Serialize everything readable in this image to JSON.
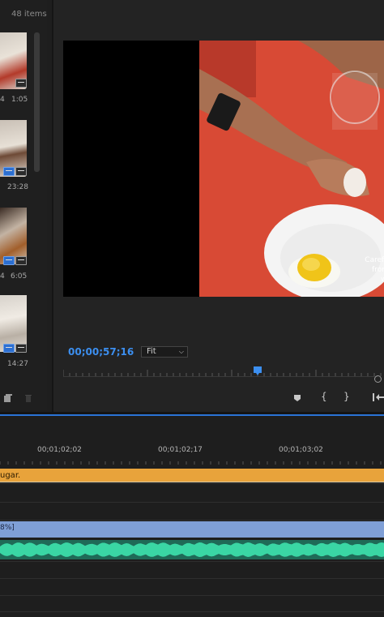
{
  "project": {
    "items_count": "48 items",
    "thumbnails": [
      {
        "index_label": "4",
        "duration": "1:05",
        "badge": "grey"
      },
      {
        "index_label": "",
        "duration": "23:28",
        "badge": "blue"
      },
      {
        "index_label": "4",
        "duration": "6:05",
        "badge": "blue"
      },
      {
        "index_label": "",
        "duration": "14:27",
        "badge": "blue"
      }
    ]
  },
  "monitor": {
    "timecode": "00;00;57;16",
    "zoom_select": "Fit",
    "overlay_text": "Carefu from wi"
  },
  "timeline": {
    "ruler_labels": [
      "00;01;02;02",
      "00;01;02;17",
      "00;01;03;02"
    ],
    "caption_clip": "ugar.",
    "video_clip": "8%]"
  },
  "colors": {
    "accent": "#3c8ff0",
    "caption_clip": "#e8a33b",
    "video_clip": "#7f9fd6",
    "audio_clip": "#1f6a57",
    "waveform": "#3ad6a4"
  }
}
